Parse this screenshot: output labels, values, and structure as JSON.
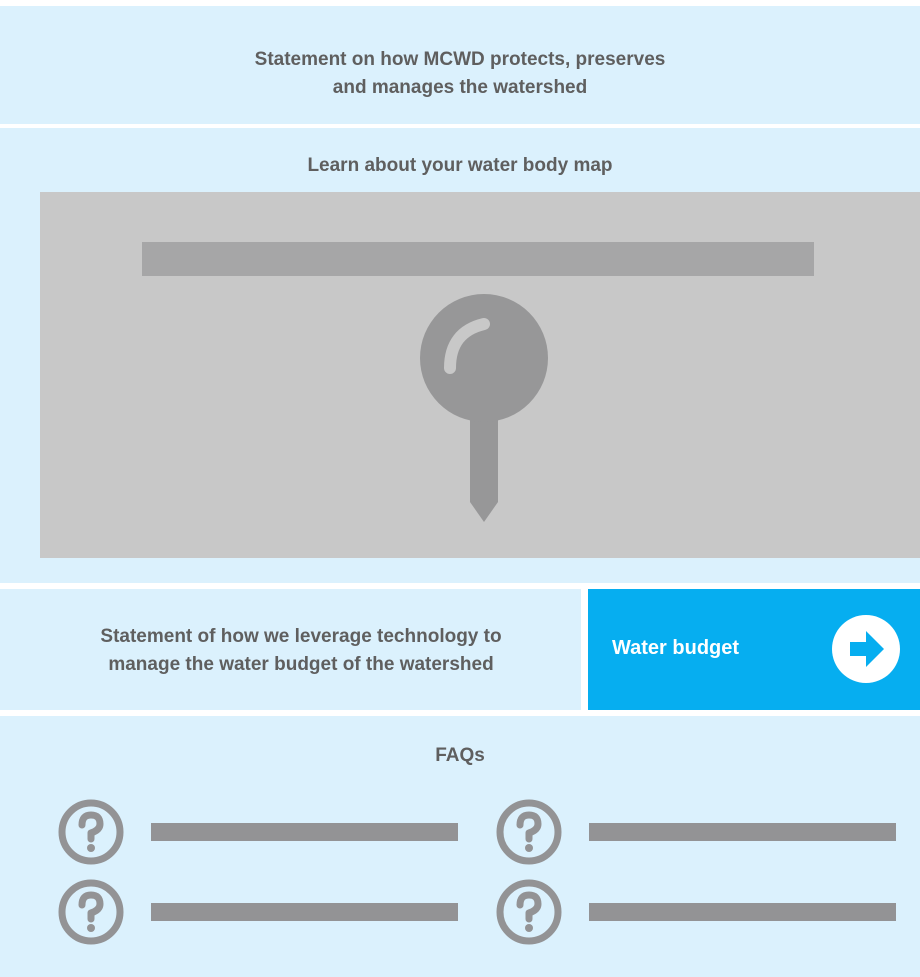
{
  "intro": {
    "statement_line1": "Statement on how MCWD protects, preserves",
    "statement_line2": "and manages the watershed"
  },
  "map_section": {
    "title": "Learn about your water body map",
    "pin_icon": "map-pin-icon"
  },
  "technology": {
    "statement_line1": "Statement of how we leverage technology to",
    "statement_line2": "manage the water budget of the watershed"
  },
  "water_budget": {
    "label": "Water budget",
    "icon": "arrow-right-circle-icon",
    "color": "#06aef0"
  },
  "faqs": {
    "title": "FAQs",
    "icon": "question-circle-icon",
    "item_count": 4
  },
  "colors": {
    "panel_bg": "#dbf1fd",
    "text": "#5f5f5f",
    "placeholder": "#939395",
    "map_bg": "#c8c8c8"
  }
}
